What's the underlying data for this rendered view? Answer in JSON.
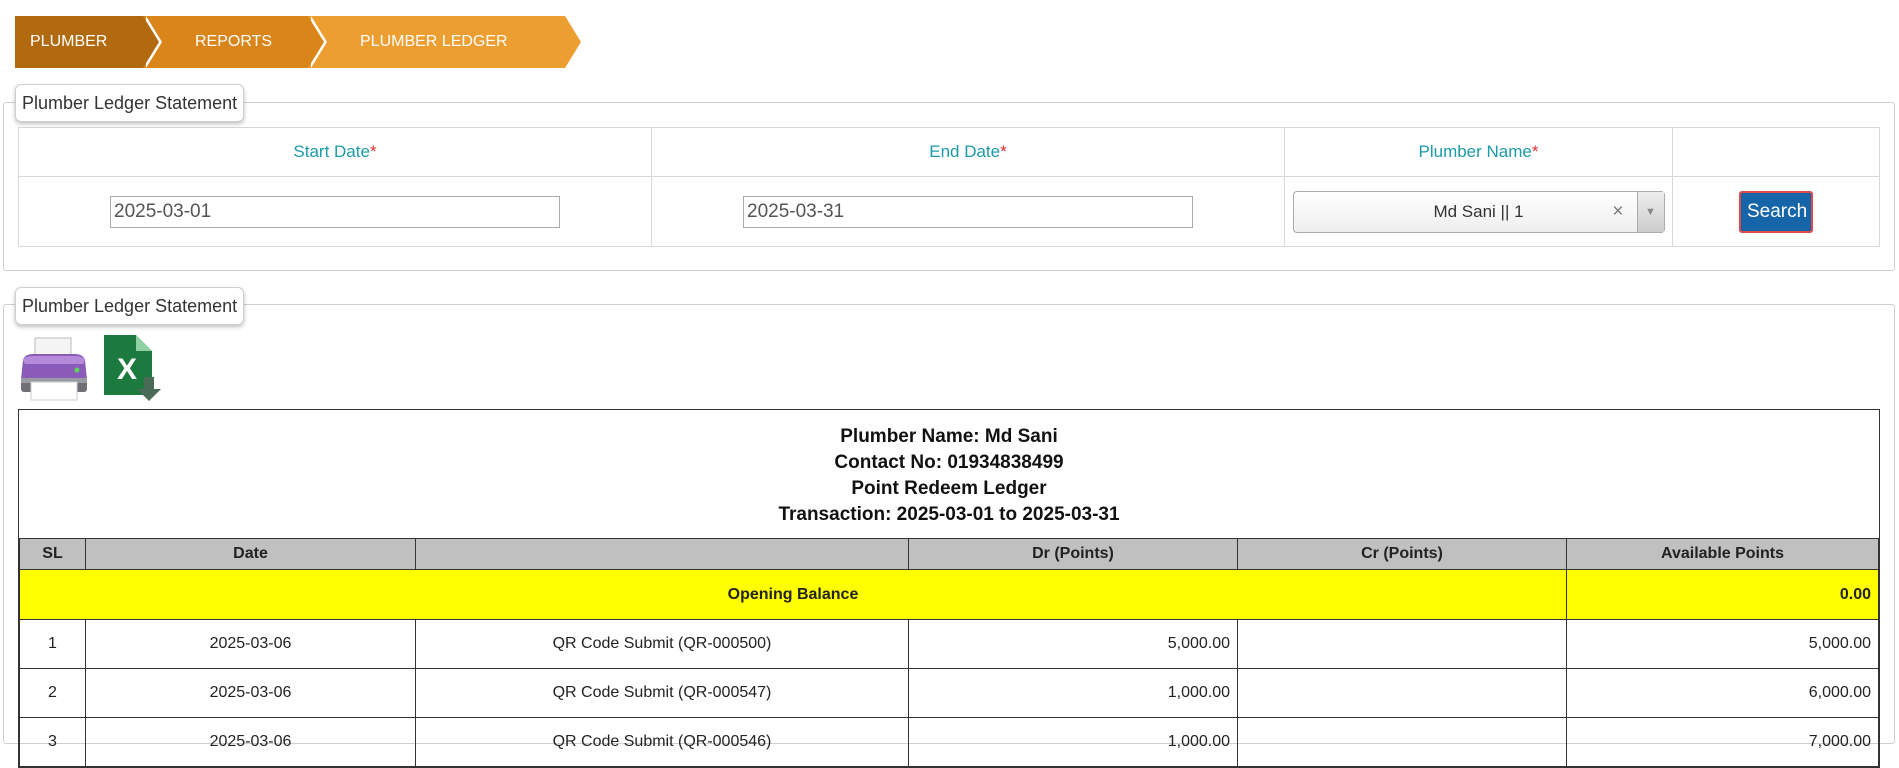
{
  "breadcrumb": [
    "PLUMBER",
    "REPORTS",
    "PLUMBER LEDGER"
  ],
  "filter_panel": {
    "legend": "Plumber Ledger Statement",
    "start_label": "Start Date",
    "end_label": "End Date",
    "plumber_label": "Plumber Name",
    "required_mark": "*",
    "start_value": "2025-03-01",
    "end_value": "2025-03-31",
    "plumber_value": "Md Sani || 1",
    "clear_symbol": "×",
    "dropdown_symbol": "▼",
    "search_label": "Search"
  },
  "report_panel": {
    "legend": "Plumber Ledger Statement",
    "print_icon": "printer-icon",
    "excel_icon": "excel-export-icon",
    "header": {
      "plumber_line": "Plumber Name: Md Sani",
      "contact_line": "Contact No: 01934838499",
      "ledger_title": "Point Redeem Ledger",
      "transaction_line": "Transaction: 2025-03-01 to 2025-03-31"
    },
    "columns": {
      "sl": "SL",
      "date": "Date",
      "description": "",
      "dr": "Dr (Points)",
      "cr": "Cr (Points)",
      "available": "Available Points"
    },
    "opening": {
      "label": "Opening Balance",
      "value": "0.00"
    },
    "rows": [
      {
        "sl": "1",
        "date": "2025-03-06",
        "desc": "QR Code Submit (QR-000500)",
        "dr": "5,000.00",
        "cr": "",
        "avail": "5,000.00"
      },
      {
        "sl": "2",
        "date": "2025-03-06",
        "desc": "QR Code Submit (QR-000547)",
        "dr": "1,000.00",
        "cr": "",
        "avail": "6,000.00"
      },
      {
        "sl": "3",
        "date": "2025-03-06",
        "desc": "QR Code Submit (QR-000546)",
        "dr": "1,000.00",
        "cr": "",
        "avail": "7,000.00"
      }
    ]
  },
  "colors": {
    "crumb_dark": "#b26a10",
    "crumb_mid": "#d9851a",
    "crumb_light": "#ec9e30",
    "label_teal": "#1b9aa8",
    "button_blue": "#1565a8",
    "opening_yellow": "#ffff00",
    "header_gray": "#c0c0c0"
  }
}
